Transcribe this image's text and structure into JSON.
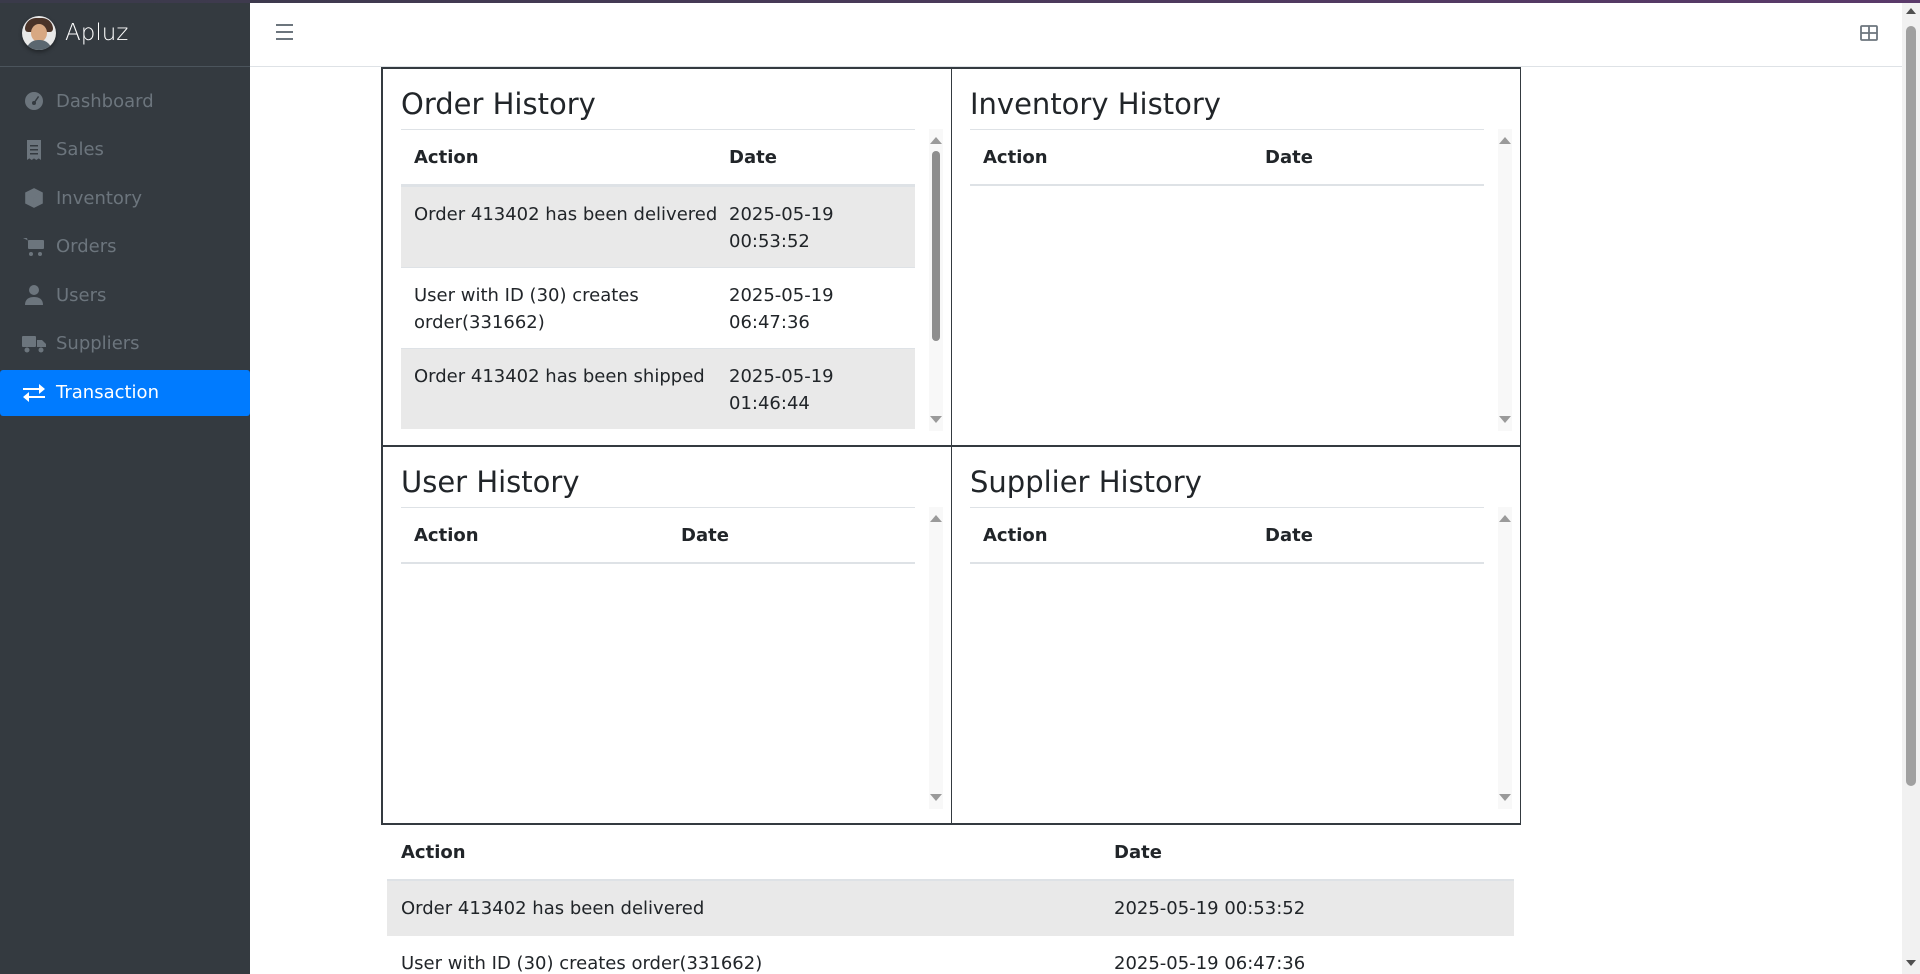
{
  "app": {
    "name": "Apluz"
  },
  "sidebar": {
    "items": [
      {
        "label": "Dashboard",
        "icon": "tachometer-icon",
        "active": false
      },
      {
        "label": "Sales",
        "icon": "receipt-icon",
        "active": false
      },
      {
        "label": "Inventory",
        "icon": "box-icon",
        "active": false
      },
      {
        "label": "Orders",
        "icon": "cart-icon",
        "active": false
      },
      {
        "label": "Users",
        "icon": "user-icon",
        "active": false
      },
      {
        "label": "Suppliers",
        "icon": "truck-icon",
        "active": false
      },
      {
        "label": "Transaction",
        "icon": "exchange-icon",
        "active": true
      }
    ]
  },
  "colors": {
    "sidebar_bg": "#343a40",
    "active": "#007bff",
    "muted": "#6c757d",
    "row_shade": "#e9e9e9"
  },
  "panels": {
    "order": {
      "title": "Order History",
      "col_action": "Action",
      "col_date": "Date",
      "rows": [
        {
          "action_1": "Order 413402 has been delivered",
          "action_2": "",
          "date_1": "2025-05-19",
          "date_2": "00:53:52"
        },
        {
          "action_1": "User with ID (30) creates",
          "action_2": "order(331662)",
          "date_1": "2025-05-19",
          "date_2": "06:47:36"
        },
        {
          "action_1": "Order 413402 has been shipped",
          "action_2": "",
          "date_1": "2025-05-19",
          "date_2": "01:46:44"
        }
      ]
    },
    "inventory": {
      "title": "Inventory History",
      "col_action": "Action",
      "col_date": "Date"
    },
    "user": {
      "title": "User History",
      "col_action": "Action",
      "col_date": "Date"
    },
    "supplier": {
      "title": "Supplier History",
      "col_action": "Action",
      "col_date": "Date"
    }
  },
  "bottom_table": {
    "col_action": "Action",
    "col_date": "Date",
    "rows": [
      {
        "action": "Order 413402 has been delivered",
        "date": "2025-05-19 00:53:52"
      },
      {
        "action": "User with ID (30) creates order(331662)",
        "date": "2025-05-19 06:47:36"
      }
    ]
  }
}
